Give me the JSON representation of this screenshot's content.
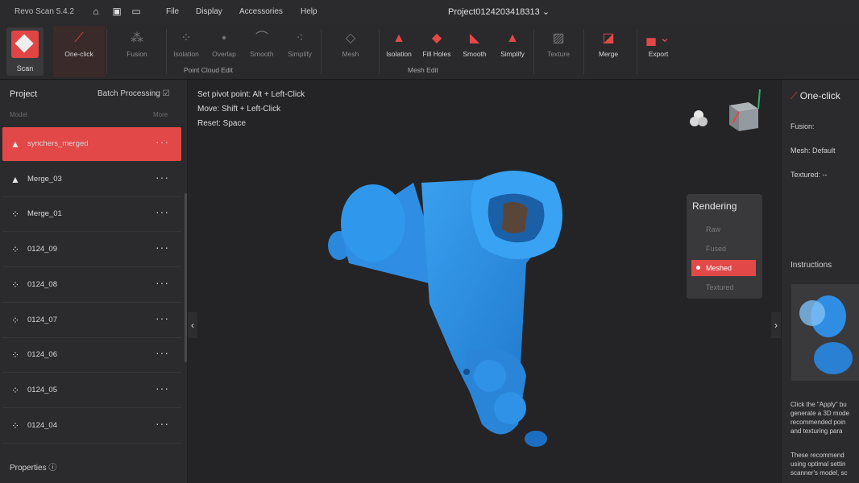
{
  "titlebar": {
    "app_name": "Revo Scan 5.4.2",
    "menus": [
      "File",
      "Display",
      "Accessories",
      "Help"
    ],
    "project_name": "Project0124203418313"
  },
  "toolbar": {
    "scan_label": "Scan",
    "tools": [
      {
        "label": "One-click",
        "active": true
      },
      {
        "label": "Fusion"
      },
      {
        "label": "Isolation"
      },
      {
        "label": "Overlap"
      },
      {
        "label": "Smooth"
      },
      {
        "label": "Simplify"
      },
      {
        "label": "Mesh"
      },
      {
        "label": "Isolation"
      },
      {
        "label": "Fill Holes"
      },
      {
        "label": "Smooth"
      },
      {
        "label": "Simplify"
      },
      {
        "label": "Texture"
      },
      {
        "label": "Merge"
      },
      {
        "label": "Export"
      }
    ],
    "group_point_cloud": "Point Cloud Edit",
    "group_mesh": "Mesh Edit"
  },
  "project_panel": {
    "title": "Project",
    "batch_label": "Batch Processing",
    "col_model": "Model",
    "col_more": "More",
    "items": [
      {
        "name": "synchers_merged",
        "icon": "mesh-icon",
        "selected": true
      },
      {
        "name": "Merge_03",
        "icon": "mesh-icon"
      },
      {
        "name": "Merge_01",
        "icon": "pointcloud-icon"
      },
      {
        "name": "0124_09",
        "icon": "pointcloud-icon"
      },
      {
        "name": "0124_08",
        "icon": "pointcloud-icon"
      },
      {
        "name": "0124_07",
        "icon": "pointcloud-icon"
      },
      {
        "name": "0124_06",
        "icon": "pointcloud-icon"
      },
      {
        "name": "0124_05",
        "icon": "pointcloud-icon"
      },
      {
        "name": "0124_04",
        "icon": "pointcloud-icon"
      }
    ],
    "more_glyph": "···",
    "properties_label": "Properties"
  },
  "viewport": {
    "hints": [
      "Set pivot point: Alt + Left-Click",
      "Move: Shift + Left-Click",
      "Reset: Space"
    ]
  },
  "rendering": {
    "title": "Rendering",
    "options": [
      {
        "label": "Raw"
      },
      {
        "label": "Fused"
      },
      {
        "label": "Meshed",
        "selected": true
      },
      {
        "label": "Textured"
      }
    ]
  },
  "right_panel": {
    "title": "One-click",
    "fusion": "Fusion:",
    "mesh": "Mesh: Default",
    "textured": "Textured: --",
    "instructions": "Instructions",
    "para1": [
      "Click the \"Apply\" bu",
      "generate a 3D mode",
      "recommended poin",
      "and texturing para"
    ],
    "para2": [
      "These recommend",
      "using optimal settin",
      "scanner's model, sc"
    ]
  },
  "colors": {
    "accent": "#e24848",
    "model": "#2f8fe0"
  }
}
